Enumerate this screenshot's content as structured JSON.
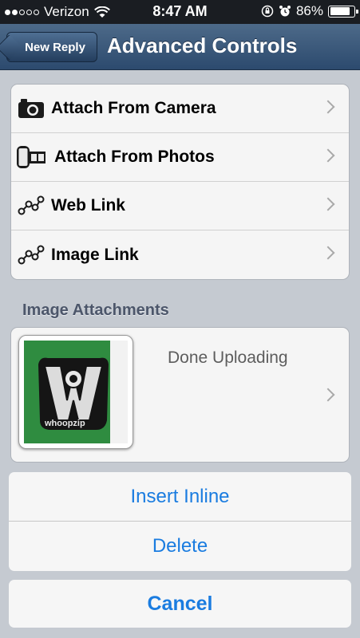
{
  "status_bar": {
    "carrier": "Verizon",
    "time": "8:47 AM",
    "battery": "86%",
    "signal_bars_filled": 2,
    "signal_bars_total": 5,
    "battery_level": 0.86
  },
  "nav": {
    "back_label": "New Reply",
    "title": "Advanced Controls"
  },
  "menu": {
    "items": [
      {
        "label": "Attach From Camera",
        "icon": "camera-icon"
      },
      {
        "label": "Attach From Photos",
        "icon": "film-icon"
      },
      {
        "label": "Web Link",
        "icon": "link-icon"
      },
      {
        "label": "Image Link",
        "icon": "link-icon"
      }
    ]
  },
  "attachments": {
    "header": "Image Attachments",
    "items": [
      {
        "status": "Done Uploading",
        "thumb_text": "whoopzip"
      }
    ]
  },
  "action_sheet": {
    "insert_label": "Insert Inline",
    "delete_label": "Delete",
    "cancel_label": "Cancel"
  },
  "colors": {
    "nav_bar": "#2c4a6e",
    "action_text": "#1a7ce0",
    "background": "#c5cad1"
  }
}
